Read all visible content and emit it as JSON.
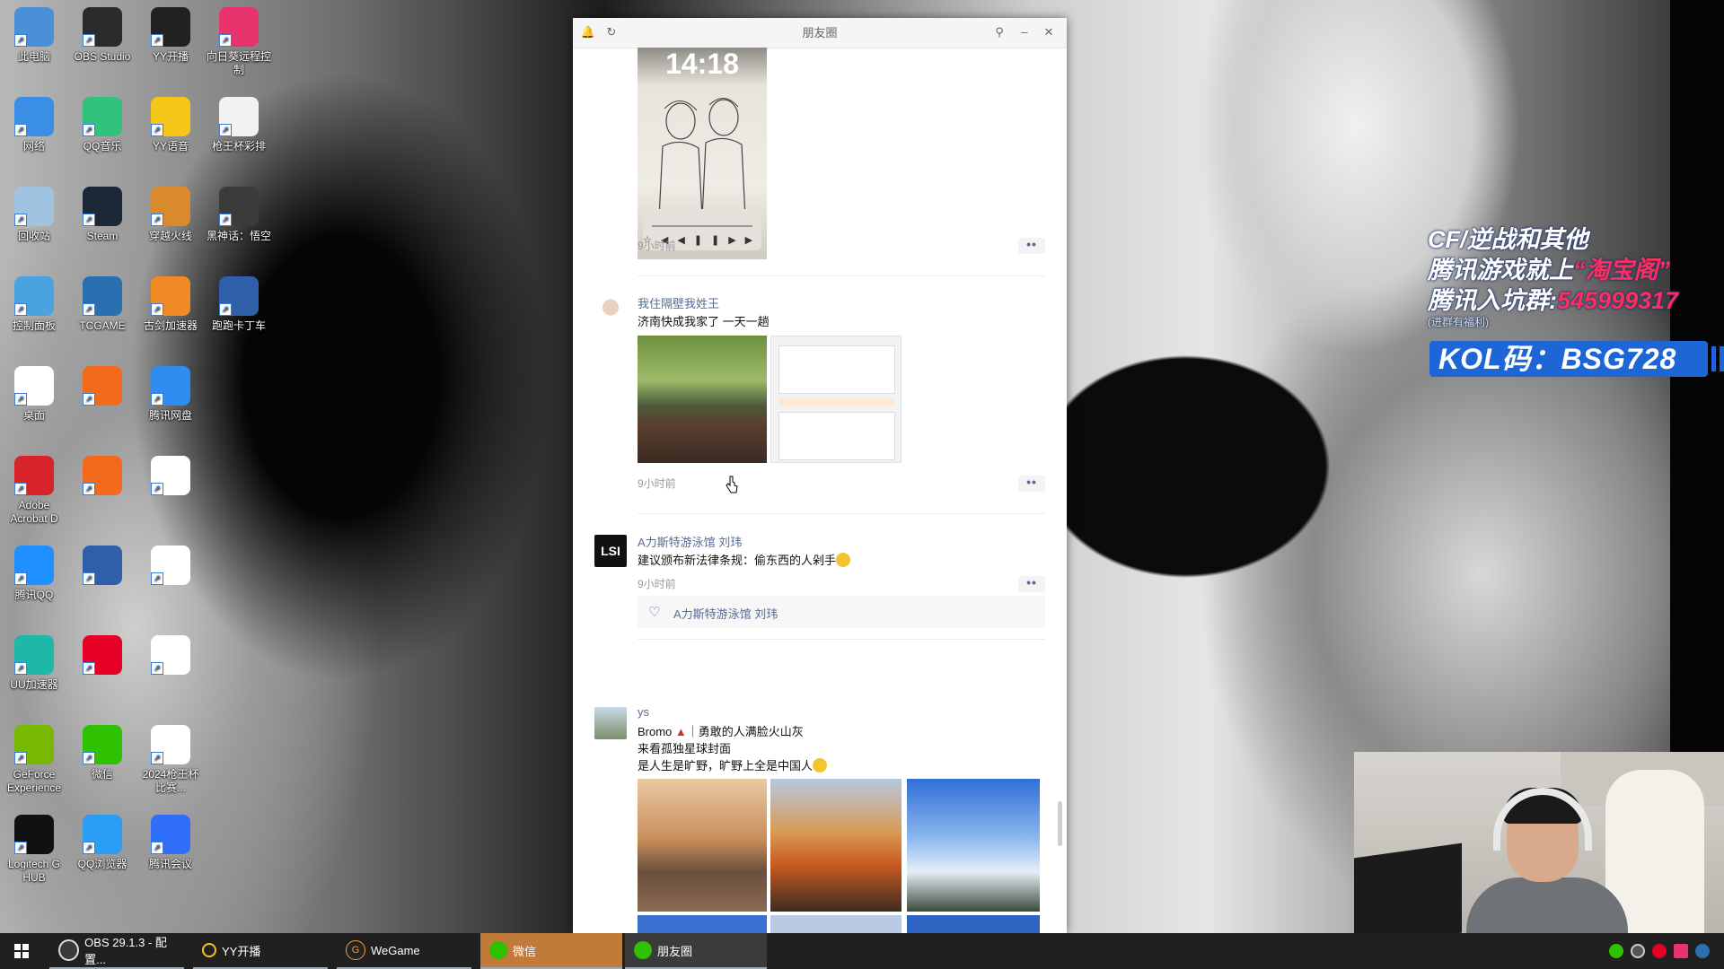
{
  "desktop": {
    "icons": [
      {
        "label": "此电脑",
        "icon": "computer-icon",
        "color": "#4a90d9"
      },
      {
        "label": "OBS Studio",
        "icon": "obs-icon",
        "color": "#2b2b2b"
      },
      {
        "label": "YY开播",
        "icon": "yy-live-icon",
        "color": "#222222"
      },
      {
        "label": "向日葵远程控制",
        "icon": "sunlogin-icon",
        "color": "#e8336d"
      },
      {
        "label": "网络",
        "icon": "network-icon",
        "color": "#3a8ee6"
      },
      {
        "label": "QQ音乐",
        "icon": "qqmusic-icon",
        "color": "#31c27c"
      },
      {
        "label": "YY语音",
        "icon": "yy-voice-icon",
        "color": "#f5c518"
      },
      {
        "label": "枪王杯彩排",
        "icon": "document-icon",
        "color": "#f2f2f2"
      },
      {
        "label": "回收站",
        "icon": "recycle-bin-icon",
        "color": "#9fc3e0"
      },
      {
        "label": "Steam",
        "icon": "steam-icon",
        "color": "#1b2838"
      },
      {
        "label": "穿越火线",
        "icon": "crossfire-icon",
        "color": "#d98b2b"
      },
      {
        "label": "黑神话：悟空",
        "icon": "wukong-icon",
        "color": "#3b3b3b"
      },
      {
        "label": "控制面板",
        "icon": "control-panel-icon",
        "color": "#4aa3df"
      },
      {
        "label": "TCGAME",
        "icon": "tcgame-icon",
        "color": "#2a6fb0"
      },
      {
        "label": "古剑加速器",
        "icon": "accelerator-icon",
        "color": "#f08a24"
      },
      {
        "label": "跑跑卡丁车",
        "icon": "kart-icon",
        "color": "#2f5fa8"
      },
      {
        "label": "桌面",
        "icon": "image-file-icon",
        "color": "#ffffff"
      },
      {
        "label": "",
        "icon": "game-bird-icon",
        "color": "#f26b1d"
      },
      {
        "label": "腾讯网盘",
        "icon": "cloud-drive-icon",
        "color": "#2f8cf0"
      },
      {
        "label": "Adobe Acrobat D",
        "icon": "acrobat-icon",
        "color": "#d8232a"
      },
      {
        "label": "",
        "icon": "game-bird-icon",
        "color": "#f26b1d"
      },
      {
        "label": "",
        "icon": "image-file-icon",
        "color": "#ffffff"
      },
      {
        "label": "腾讯QQ",
        "icon": "qq-icon",
        "color": "#1e90ff"
      },
      {
        "label": "",
        "icon": "kart-icon",
        "color": "#2f5fa8"
      },
      {
        "label": "",
        "icon": "image-file-icon",
        "color": "#ffffff"
      },
      {
        "label": "UU加速器",
        "icon": "uu-icon",
        "color": "#1fb8a8"
      },
      {
        "label": "",
        "icon": "netease-music-icon",
        "color": "#e60026"
      },
      {
        "label": "",
        "icon": "pdf-icon",
        "color": "#ffffff"
      },
      {
        "label": "GeForce Experience",
        "icon": "geforce-icon",
        "color": "#76b900"
      },
      {
        "label": "微信",
        "icon": "wechat-icon",
        "color": "#2dc100"
      },
      {
        "label": "2024枪王杯比赛...",
        "icon": "pdf-icon",
        "color": "#ffffff"
      },
      {
        "label": "Logitech G HUB",
        "icon": "logitech-icon",
        "color": "#111111"
      },
      {
        "label": "QQ浏览器",
        "icon": "qq-browser-icon",
        "color": "#2a9df4"
      },
      {
        "label": "腾讯会议",
        "icon": "meeting-icon",
        "color": "#2f6ef6"
      }
    ]
  },
  "overlay": {
    "line1": "CF/逆战和其他",
    "line2a": "腾讯游戏就上",
    "line2b": "“淘宝阁”",
    "line3a": "腾讯入坑群:",
    "line3b": "545999317",
    "line4": "(进群有福利)",
    "kol": "KOL码：BSG728"
  },
  "moments": {
    "title": "朋友圈",
    "icons": {
      "left1": "bell-icon",
      "left2": "refresh-icon",
      "pin": "pin-icon",
      "min": "minimize-icon",
      "close": "close-icon"
    },
    "posts": [
      {
        "time": "9小时前",
        "image_clock": "14:18",
        "more": "••"
      },
      {
        "name": "我住隔壁我姓王",
        "text": "济南快成我家了 一天一趟",
        "time": "9小时前",
        "more": "••"
      },
      {
        "name": "A力斯特游泳馆 刘玮",
        "text": "建议颁布新法律条规：偷东西的人剁手",
        "time": "9小时前",
        "more": "••",
        "likes": "A力斯特游泳馆 刘玮"
      },
      {
        "name": "ys",
        "text1": "Bromo",
        "text1b": "｜勇敢的人满脸火山灰",
        "text2": "来看孤独星球封面",
        "text3": "是人生是旷野，旷野上全是中国人"
      }
    ]
  },
  "taskbar": {
    "items": [
      {
        "label": "OBS 29.1.3 - 配置...",
        "icon": "obs-icon"
      },
      {
        "label": "YY开播",
        "icon": "yy-live-icon"
      },
      {
        "label": "WeGame",
        "icon": "wegame-icon"
      },
      {
        "label": "微信",
        "icon": "wechat-icon"
      },
      {
        "label": "朋友圈",
        "icon": "moments-icon"
      }
    ],
    "colors": {
      "wechat_active": "#c07a3a",
      "moments_active": "#3b3b3b"
    }
  }
}
